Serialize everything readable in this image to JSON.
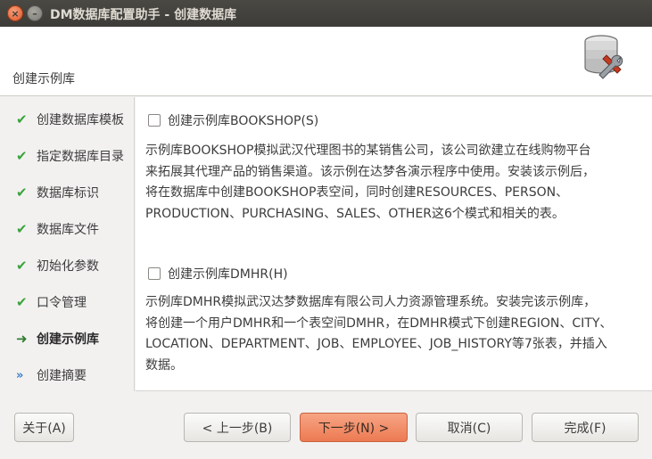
{
  "window": {
    "title": "DM数据库配置助手 - 创建数据库",
    "close_glyph": "×",
    "minimize_glyph": "–"
  },
  "header": {
    "title": "创建示例库",
    "icon": "database-tools-icon"
  },
  "sidebar": {
    "items": [
      {
        "label": "创建数据库模板",
        "state": "done"
      },
      {
        "label": "指定数据库目录",
        "state": "done"
      },
      {
        "label": "数据库标识",
        "state": "done"
      },
      {
        "label": "数据库文件",
        "state": "done"
      },
      {
        "label": "初始化参数",
        "state": "done"
      },
      {
        "label": "口令管理",
        "state": "done"
      },
      {
        "label": "创建示例库",
        "state": "current"
      },
      {
        "label": "创建摘要",
        "state": "pending"
      }
    ],
    "glyphs": {
      "done": "✔",
      "current": "➜",
      "pending": "»"
    }
  },
  "content": {
    "bookshop": {
      "label": "创建示例库BOOKSHOP(S)",
      "checked": false,
      "description": [
        "示例库BOOKSHOP模拟武汉代理图书的某销售公司，该公司欲建立在线购物平台",
        "来拓展其代理产品的销售渠道。该示例在达梦各演示程序中使用。安装该示例后，",
        "将在数据库中创建BOOKSHOP表空间，同时创建RESOURCES、PERSON、",
        "PRODUCTION、PURCHASING、SALES、OTHER这6个模式和相关的表。"
      ]
    },
    "dmhr": {
      "label": "创建示例库DMHR(H)",
      "checked": false,
      "description": [
        "示例库DMHR模拟武汉达梦数据库有限公司人力资源管理系统。安装完该示例库，",
        "将创建一个用户DMHR和一个表空间DMHR，在DMHR模式下创建REGION、CITY、",
        "LOCATION、DEPARTMENT、JOB、EMPLOYEE、JOB_HISTORY等7张表，并插入",
        "数据。"
      ]
    }
  },
  "footer": {
    "about": "关于(A)",
    "back": "< 上一步(B)",
    "next": "下一步(N) >",
    "cancel": "取消(C)",
    "finish": "完成(F)"
  },
  "colors": {
    "titlebar": "#3c3b37",
    "accent_button": "#ec7a52",
    "check_green": "#3aa43a",
    "pending_blue": "#3a7ec8"
  }
}
